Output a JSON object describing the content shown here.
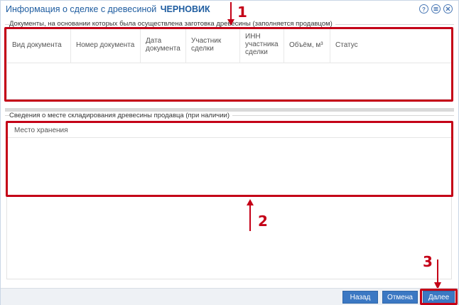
{
  "window": {
    "title": "Информация о сделке с древесиной",
    "status": "ЧЕРНОВИК"
  },
  "tool_icons": [
    "help-icon",
    "settings-icon",
    "close-icon"
  ],
  "documents_section": {
    "legend": "Документы, на основании которых была осуществлена заготовка древесины (заполняется продавцом)",
    "columns": [
      {
        "lines": [
          "Вид документа"
        ]
      },
      {
        "lines": [
          "Номер документа"
        ]
      },
      {
        "lines": [
          "Дата",
          "документа"
        ]
      },
      {
        "lines": [
          "Участник",
          "сделки"
        ]
      },
      {
        "lines": [
          "ИНН",
          "участника",
          "сделки"
        ]
      },
      {
        "lines": [
          "Объём, м³"
        ]
      },
      {
        "lines": [
          "Статус"
        ]
      }
    ]
  },
  "storage_section": {
    "legend": "Сведения о месте складирования древесины продавца (при наличии)",
    "column": "Место хранения"
  },
  "annotations": {
    "marker_1": "1",
    "marker_2": "2",
    "marker_3": "3"
  },
  "footer": {
    "back_label": "Назад",
    "cancel_label": "Отмена",
    "next_label": "Далее"
  },
  "colors": {
    "accent": "#3b78c3",
    "title": "#1f5da0",
    "highlight": "#c40017"
  }
}
